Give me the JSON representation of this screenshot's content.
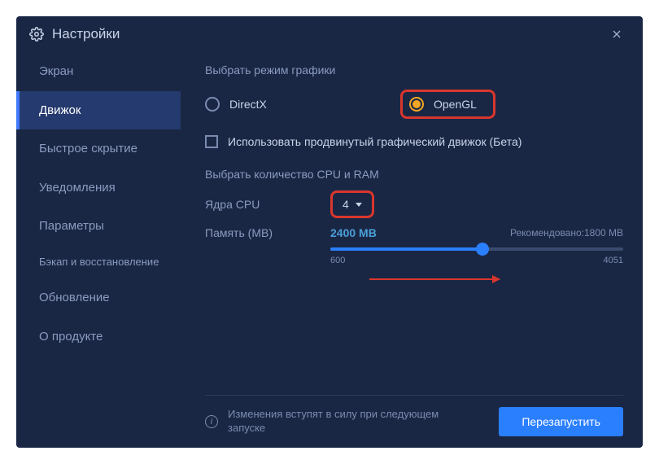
{
  "window": {
    "title": "Настройки"
  },
  "sidebar": {
    "items": [
      {
        "label": "Экран"
      },
      {
        "label": "Движок"
      },
      {
        "label": "Быстрое скрытие"
      },
      {
        "label": "Уведомления"
      },
      {
        "label": "Параметры"
      },
      {
        "label": "Бэкап и восстановление"
      },
      {
        "label": "Обновление"
      },
      {
        "label": "О продукте"
      }
    ]
  },
  "graphics": {
    "section_label": "Выбрать режим графики",
    "options": [
      {
        "label": "DirectX"
      },
      {
        "label": "OpenGL"
      }
    ],
    "advanced_label": "Использовать продвинутый графический движок (Бета)"
  },
  "cpuram": {
    "section_label": "Выбрать количество CPU и RAM",
    "cpu_label": "Ядра CPU",
    "cpu_value": "4",
    "mem_label": "Память (MB)",
    "mem_value": "2400 MB",
    "recommended": "Рекомендовано:1800 MB",
    "slider_min": "600",
    "slider_max": "4051"
  },
  "footer": {
    "notice": "Изменения вступят в силу при следующем запуске",
    "restart_label": "Перезапустить"
  }
}
